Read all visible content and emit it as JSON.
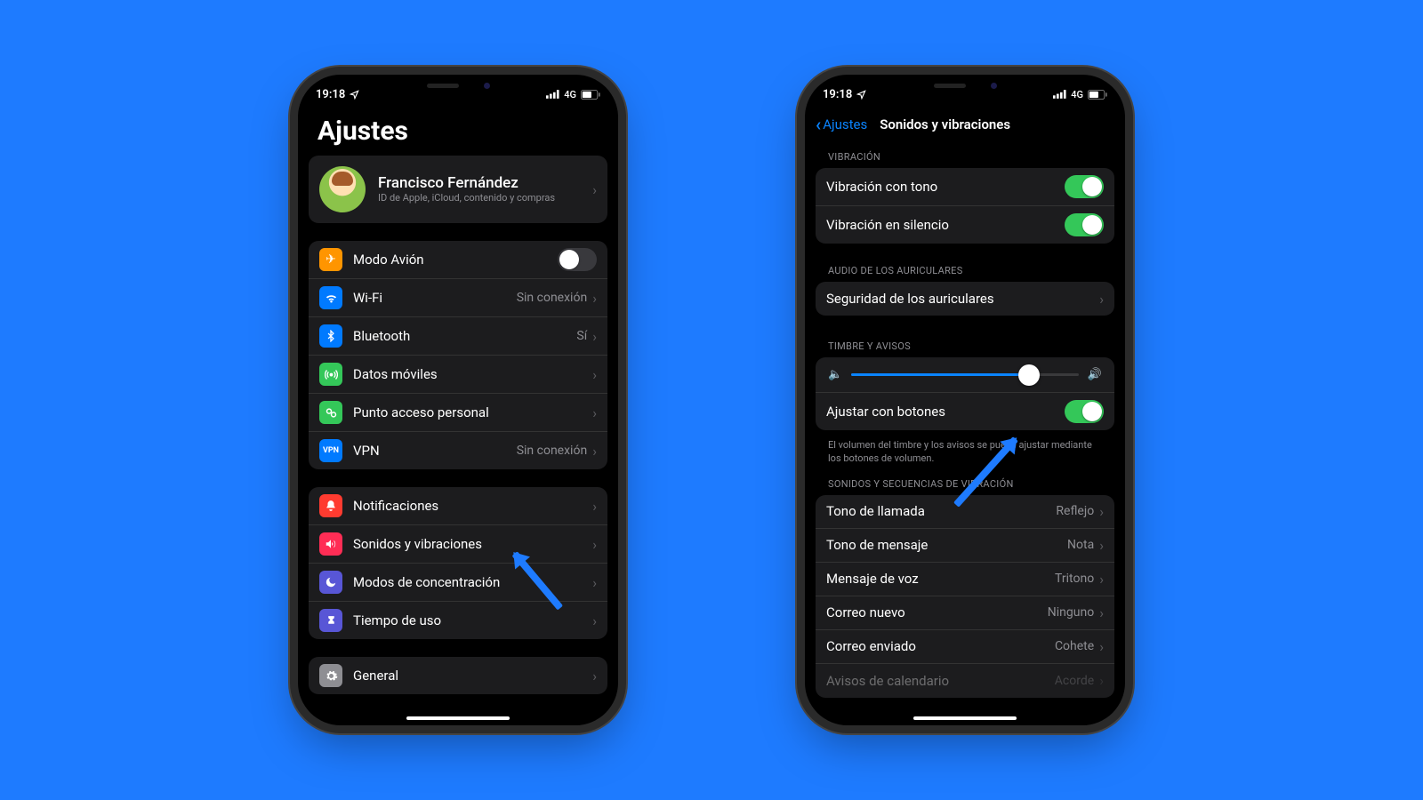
{
  "status": {
    "time": "19:18",
    "net": "4G"
  },
  "left": {
    "title": "Ajustes",
    "profile": {
      "name": "Francisco Fernández",
      "sub": "ID de Apple, iCloud, contenido y compras"
    },
    "g1": {
      "airplane": "Modo Avión",
      "wifi": "Wi-Fi",
      "wifi_v": "Sin conexión",
      "bt": "Bluetooth",
      "bt_v": "Sí",
      "cell": "Datos móviles",
      "hotspot": "Punto acceso personal",
      "vpn": "VPN",
      "vpn_v": "Sin conexión"
    },
    "g2": {
      "notif": "Notificaciones",
      "sounds": "Sonidos y vibraciones",
      "focus": "Modos de concentración",
      "screentime": "Tiempo de uso"
    },
    "g3": {
      "general": "General"
    }
  },
  "right": {
    "back": "Ajustes",
    "title": "Sonidos y vibraciones",
    "sec_vib": "VIBRACIÓN",
    "vib_ring": "Vibración con tono",
    "vib_silent": "Vibración en silencio",
    "sec_headphone": "AUDIO DE LOS AURICULARES",
    "headphone_safety": "Seguridad de los auriculares",
    "sec_ringer": "TIMBRE Y AVISOS",
    "adjust_buttons": "Ajustar con botones",
    "ringer_note": "El volumen del timbre y los avisos se puede ajustar mediante los botones de volumen.",
    "sec_patterns": "SONIDOS Y SECUENCIAS DE VIBRACIÓN",
    "ringtone": "Tono de llamada",
    "ringtone_v": "Reflejo",
    "text": "Tono de mensaje",
    "text_v": "Nota",
    "vm": "Mensaje de voz",
    "vm_v": "Tritono",
    "newmail": "Correo nuevo",
    "newmail_v": "Ninguno",
    "sentmail": "Correo enviado",
    "sentmail_v": "Cohete",
    "cal": "Avisos de calendario",
    "cal_v": "Acorde",
    "slider_pct": 78
  }
}
